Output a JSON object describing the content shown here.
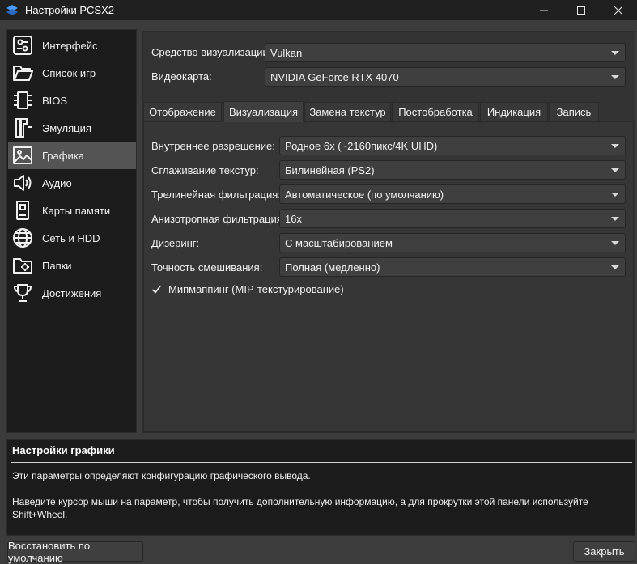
{
  "window": {
    "title": "Настройки PCSX2"
  },
  "sidebar": {
    "items": [
      {
        "label": "Интерфейс",
        "icon": "settings-window-icon"
      },
      {
        "label": "Список игр",
        "icon": "folder-open-icon"
      },
      {
        "label": "BIOS",
        "icon": "chip-icon"
      },
      {
        "label": "Эмуляция",
        "icon": "emulation-icon"
      },
      {
        "label": "Графика",
        "icon": "image-icon"
      },
      {
        "label": "Аудио",
        "icon": "speaker-icon"
      },
      {
        "label": "Карты памяти",
        "icon": "memory-card-icon"
      },
      {
        "label": "Сеть и HDD",
        "icon": "globe-icon"
      },
      {
        "label": "Папки",
        "icon": "folder-settings-icon"
      },
      {
        "label": "Достижения",
        "icon": "trophy-icon"
      }
    ],
    "active": "Графика"
  },
  "renderer": {
    "label": "Средство визуализации:",
    "value": "Vulkan"
  },
  "adapter": {
    "label": "Видеокарта:",
    "value": "NVIDIA GeForce RTX 4070"
  },
  "tabs": [
    "Отображение",
    "Визуализация",
    "Замена текстур",
    "Постобработка",
    "Индикация",
    "Запись"
  ],
  "active_tab": "Визуализация",
  "settings": [
    {
      "label": "Внутреннее разрешение:",
      "value": "Родное 6x (~2160пикс/4K UHD)"
    },
    {
      "label": "Сглаживание текстур:",
      "value": "Билинейная (PS2)"
    },
    {
      "label": "Трелинейная фильтрация:",
      "value": "Автоматическое (по умолчанию)"
    },
    {
      "label": "Анизотропная фильтрация:",
      "value": "16x"
    },
    {
      "label": "Дизеринг:",
      "value": "С масштабированием"
    },
    {
      "label": "Точность смешивания:",
      "value": "Полная (медленно)"
    }
  ],
  "mipmapping": {
    "label": "Мипмаппинг (MIP-текстурирование)",
    "checked": true
  },
  "info": {
    "title": "Настройки графики",
    "line1": "Эти параметры определяют конфигурацию графического вывода.",
    "line2": "Наведите курсор мыши на параметр, чтобы получить дополнительную информацию, а для прокрутки этой панели используйте",
    "line3": "Shift+Wheel."
  },
  "buttons": {
    "restore_defaults": "Восстановить по умолчанию",
    "close": "Закрыть"
  }
}
